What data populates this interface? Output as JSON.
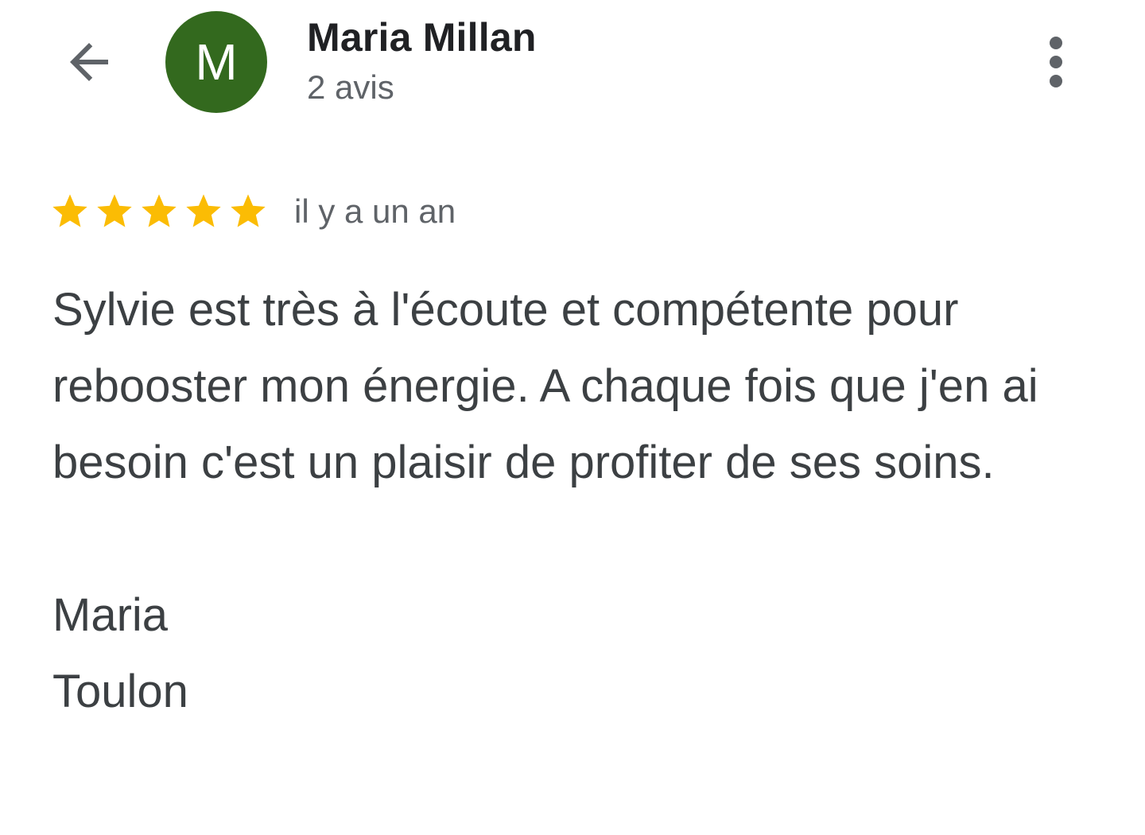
{
  "header": {
    "back_icon": "arrow-left-icon",
    "avatar": {
      "initial": "M",
      "color": "#33691e"
    },
    "reviewer_name": "Maria Millan",
    "review_count": "2 avis",
    "more_icon": "more-vert-icon"
  },
  "review": {
    "rating": 5,
    "max_rating": 5,
    "star_icon": "star-icon",
    "star_color": "#fbbc04",
    "date": "il y a un an",
    "text": "Sylvie est très à l'écoute et compétente pour rebooster mon énergie. A chaque fois que j'en ai besoin c'est un plaisir de profiter de ses soins.\n\nMaria\nToulon"
  }
}
